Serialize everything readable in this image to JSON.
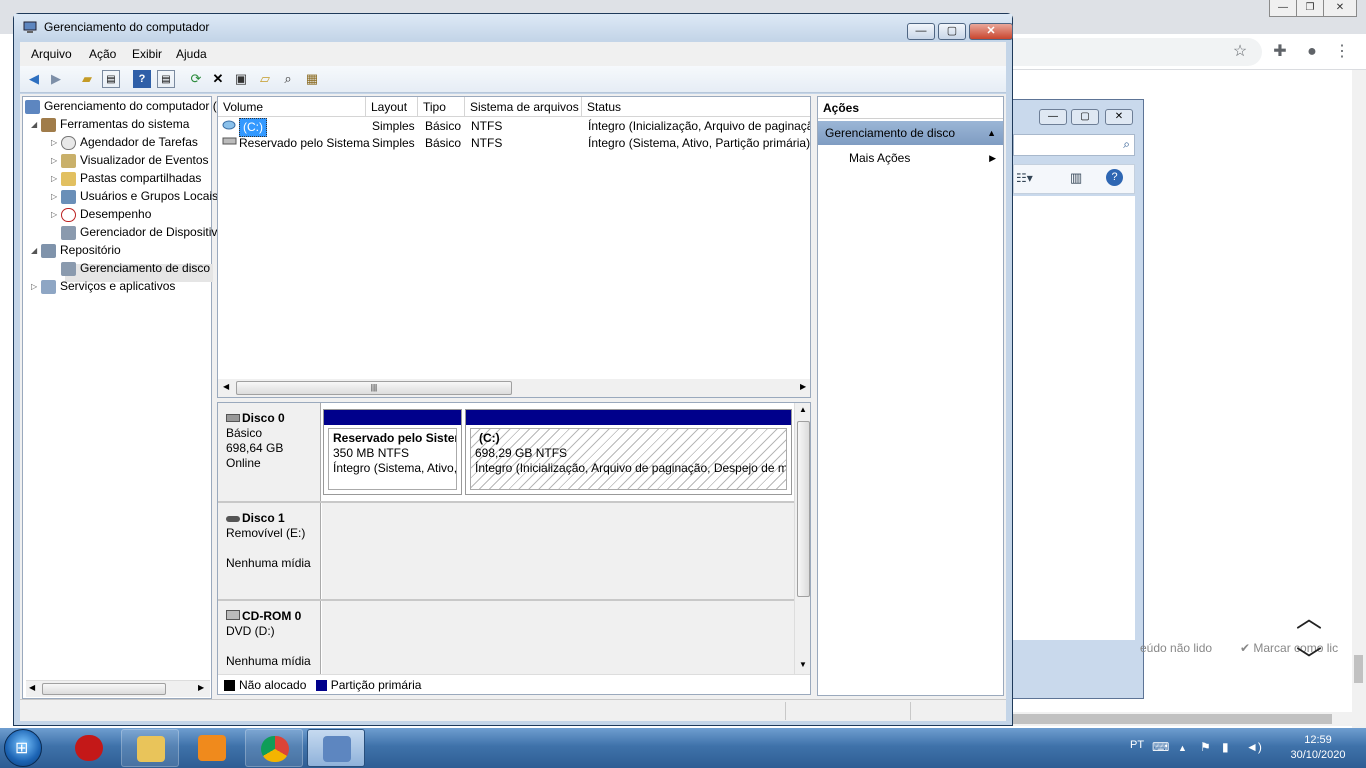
{
  "window": {
    "title": "Gerenciamento do computador",
    "btn_minimize": "—",
    "btn_maximize": "▢",
    "btn_close": "✕"
  },
  "menu": [
    "Arquivo",
    "Ação",
    "Exibir",
    "Ajuda"
  ],
  "toolbar_icons": [
    "back-icon",
    "forward-icon",
    "up-folder-icon",
    "show-hide-tree-icon",
    "help-icon",
    "show-hide-actions-icon",
    "refresh-icon",
    "delete-icon",
    "properties-icon",
    "open-icon",
    "search-disk-icon",
    "rescan-icon"
  ],
  "tree": {
    "root": "Gerenciamento do computador (Local)",
    "tools": "Ferramentas do sistema",
    "tools_children": [
      "Agendador de Tarefas",
      "Visualizador de Eventos",
      "Pastas compartilhadas",
      "Usuários e Grupos Locais",
      "Desempenho",
      "Gerenciador de Dispositivos"
    ],
    "storage": "Repositório",
    "storage_child": "Gerenciamento de disco",
    "services": "Serviços e aplicativos"
  },
  "volumes": {
    "columns": [
      "Volume",
      "Layout",
      "Tipo",
      "Sistema de arquivos",
      "Status"
    ],
    "rows": [
      [
        "(C:)",
        "Simples",
        "Básico",
        "NTFS",
        "Íntegro (Inicialização, Arquivo de paginação, Despejo de memória, Partição primária)"
      ],
      [
        "Reservado pelo Sistema",
        "Simples",
        "Básico",
        "NTFS",
        "Íntegro (Sistema, Ativo, Partição primária)"
      ]
    ]
  },
  "disks": [
    {
      "name": "Disco 0",
      "type": "Básico",
      "size": "698,64 GB",
      "state": "Online",
      "partitions": [
        {
          "name": "Reservado pelo Sistem",
          "size": "350 MB NTFS",
          "status": "Íntegro (Sistema, Ativo,"
        },
        {
          "name": "(C:)",
          "size": "698,29 GB NTFS",
          "status": "Íntegro (Inicialização, Arquivo de paginação, Despejo de me"
        }
      ]
    },
    {
      "name": "Disco 1",
      "type": "Removível (E:)",
      "size": "",
      "state": "Nenhuma mídia"
    },
    {
      "name": "CD-ROM 0",
      "type": "DVD (D:)",
      "size": "",
      "state": "Nenhuma mídia"
    }
  ],
  "legend": [
    {
      "label": "Não alocado",
      "color": "#000000"
    },
    {
      "label": "Partição primária",
      "color": "#00008b"
    }
  ],
  "actions": {
    "header": "Ações",
    "section": "Gerenciamento de disco",
    "more": "Mais Ações"
  },
  "background": {
    "unread_text": "eúdo não lido",
    "mark_read": "Marcar como lic"
  },
  "taskbar": {
    "lang": "PT",
    "time": "12:59",
    "date": "30/10/2020",
    "apps": [
      "security-app-icon",
      "file-explorer-icon",
      "media-player-icon",
      "chrome-icon",
      "computer-management-icon"
    ]
  },
  "colors": {
    "primary_partition": "#00008b",
    "actions_section_bg": "#8faacc",
    "taskbar": "#3f72aa"
  }
}
